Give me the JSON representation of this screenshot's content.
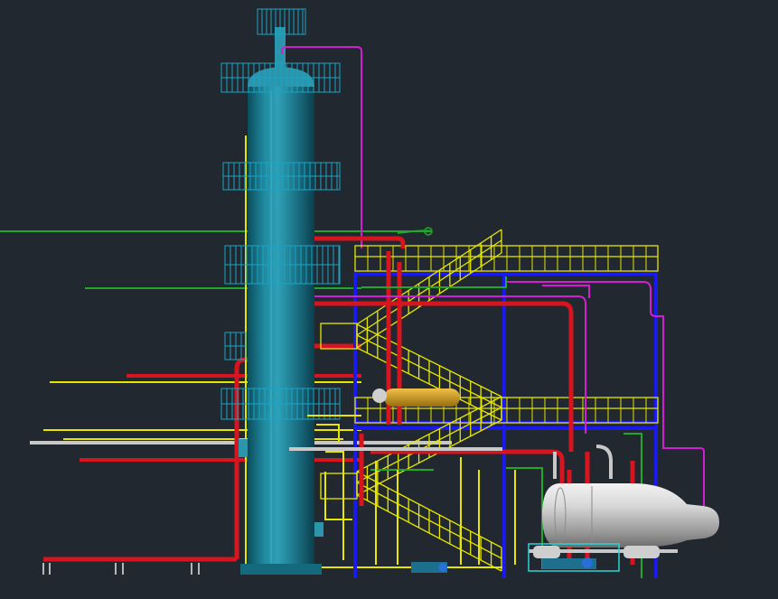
{
  "viewport": {
    "background": "#212830"
  },
  "colors": {
    "vessel": "#1f7f94",
    "vessel_dark": "#0f5566",
    "vessel_light": "#3aa3b8",
    "platform": "#1ba4c4",
    "red_pipe": "#d8141e",
    "yellow": "#e6e600",
    "yellow_dark": "#b3b300",
    "green": "#1fa82a",
    "magenta": "#d21ed2",
    "blue": "#1a1aee",
    "grey_pipe": "#c8c8c8",
    "drum": "#cfcfcf",
    "orange": "#d4a11a",
    "white": "#e6e6e6",
    "cyan": "#2ad4d4"
  },
  "equipment": {
    "column": "distillation-column",
    "structure": "steel-structure-with-stairs",
    "horizontal_drum": "reflux-drum",
    "small_drum": "small-horizontal-vessel",
    "pumps": "pump-skid"
  }
}
